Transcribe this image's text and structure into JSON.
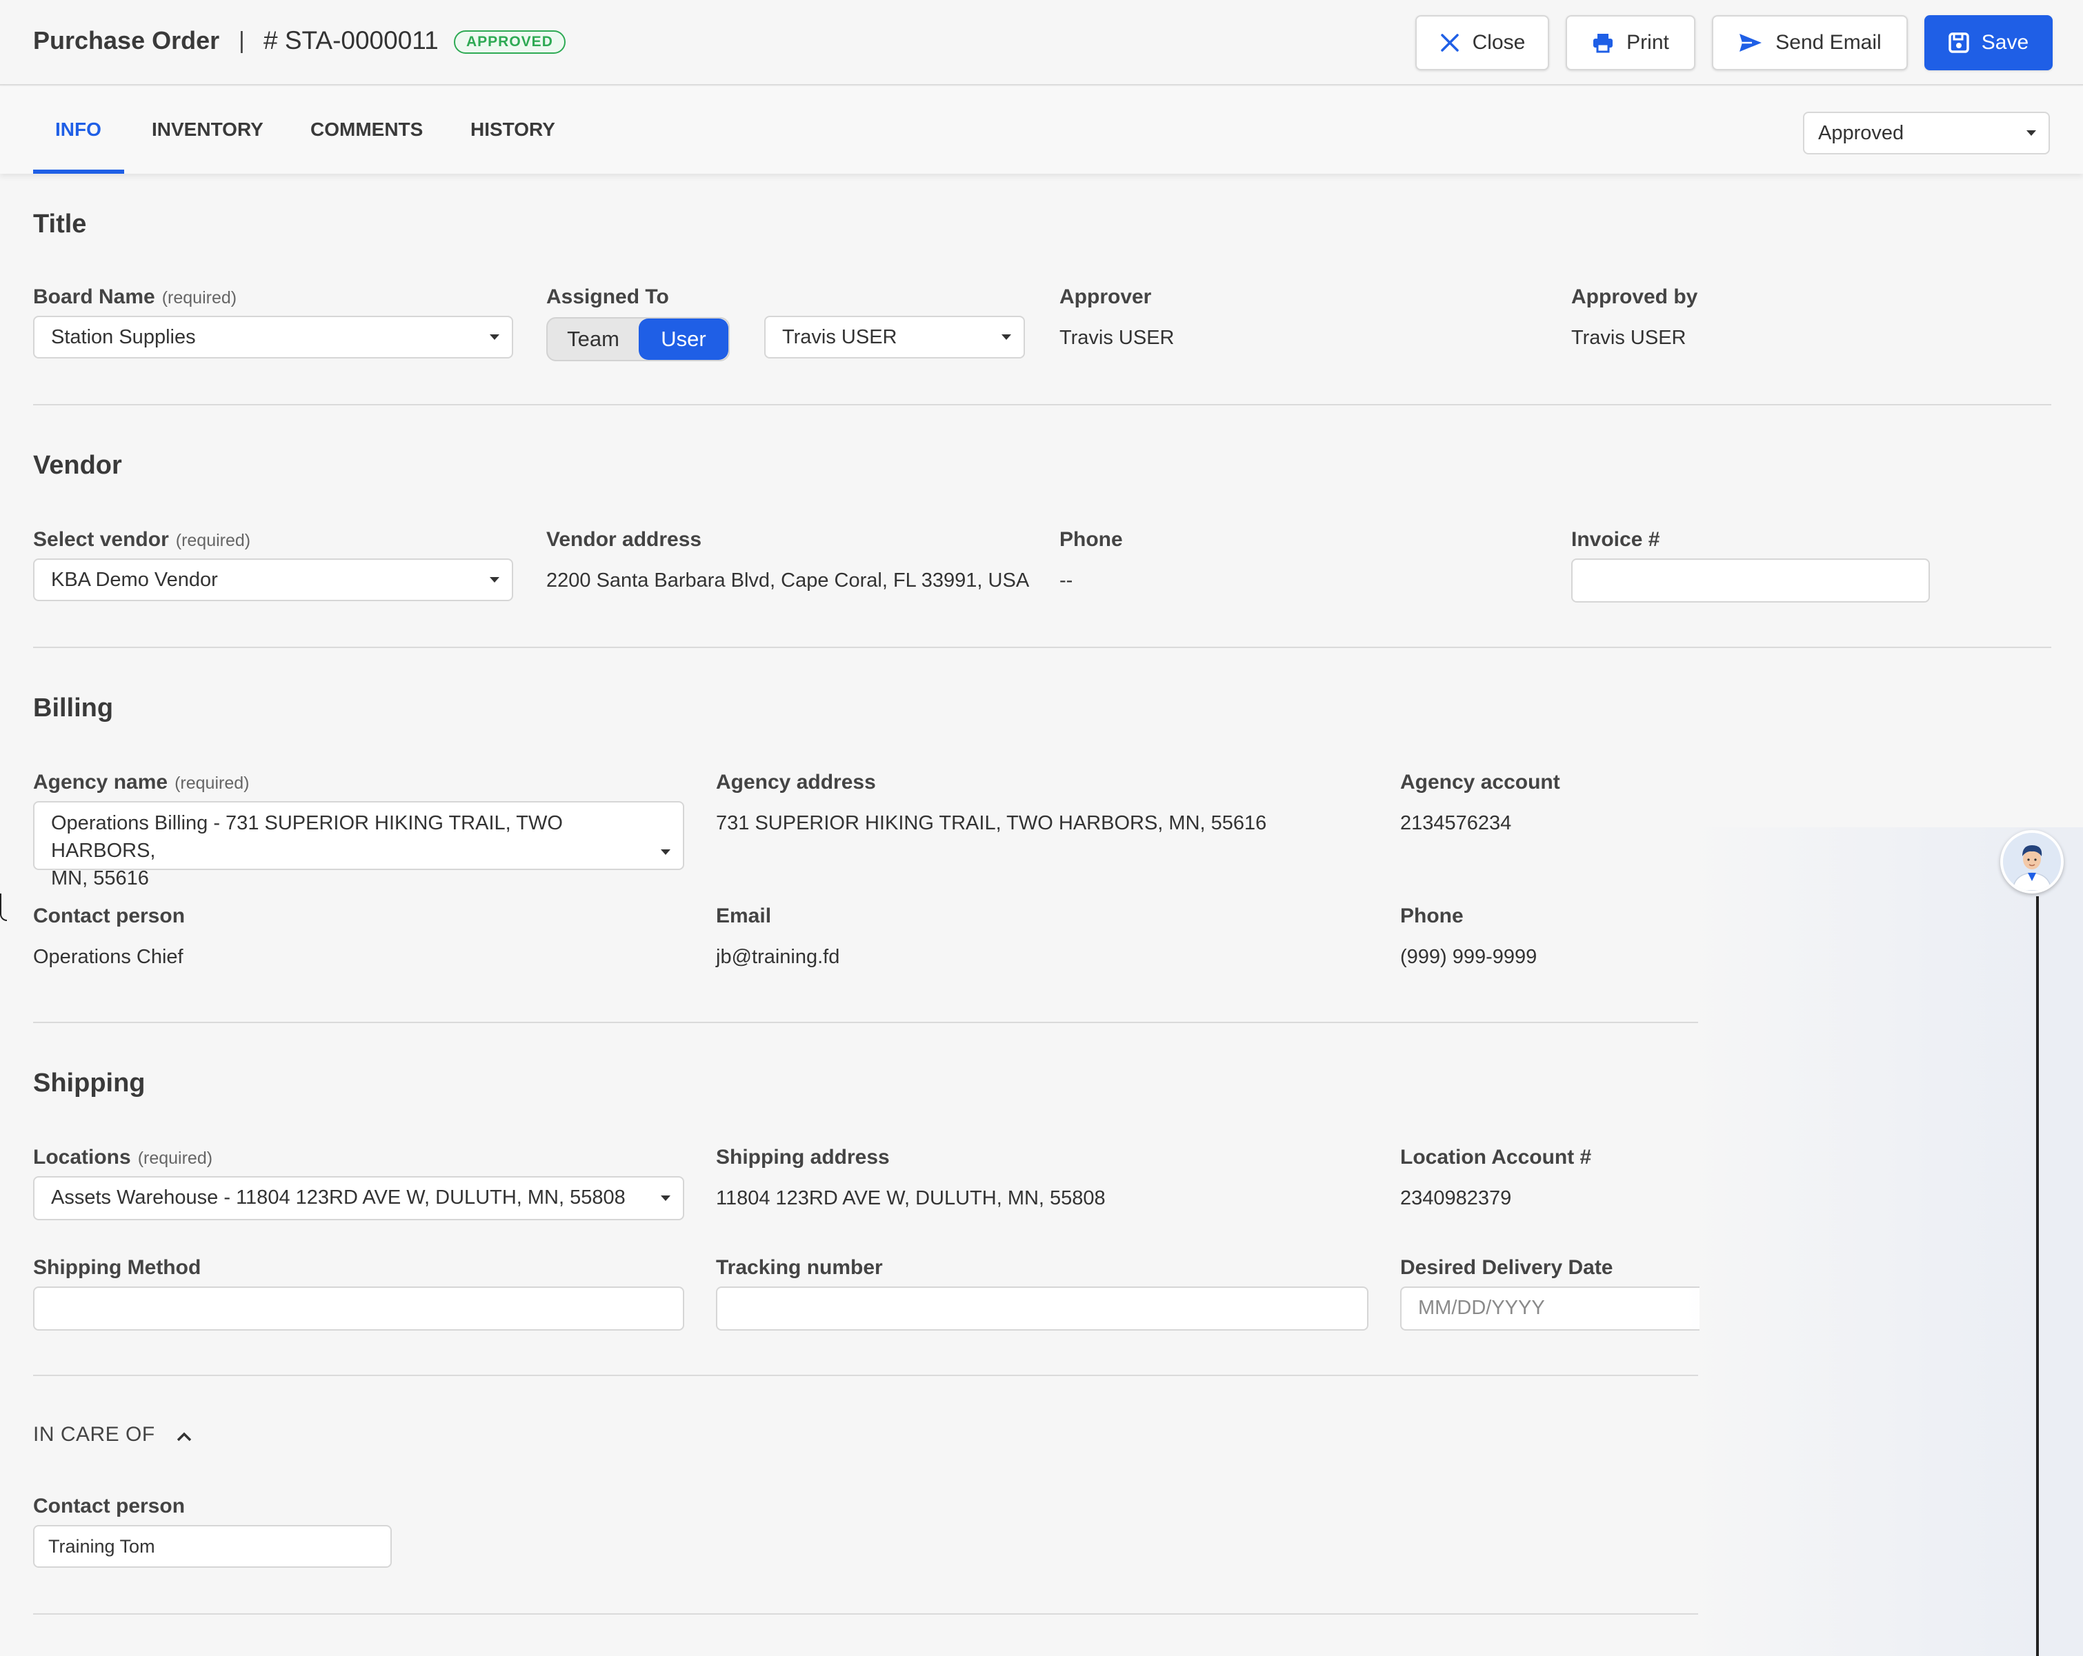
{
  "header": {
    "title": "Purchase Order",
    "separator": "|",
    "order_number": "# STA-0000011",
    "badge": "APPROVED",
    "buttons": {
      "close": "Close",
      "print": "Print",
      "send_email": "Send Email",
      "save": "Save"
    }
  },
  "tabs": [
    {
      "label": "INFO",
      "active": true
    },
    {
      "label": "INVENTORY",
      "active": false
    },
    {
      "label": "COMMENTS",
      "active": false
    },
    {
      "label": "HISTORY",
      "active": false
    }
  ],
  "status_select": {
    "value": "Approved"
  },
  "title_section": {
    "heading": "Title",
    "board_name_label": "Board Name",
    "required": "(required)",
    "board_name_value": "Station Supplies",
    "assigned_to_label": "Assigned To",
    "toggle": {
      "team": "Team",
      "user": "User",
      "selected": "User"
    },
    "assigned_user_value": "Travis USER",
    "approver_label": "Approver",
    "approver_value": "Travis USER",
    "approved_by_label": "Approved by",
    "approved_by_value": "Travis USER"
  },
  "vendor_section": {
    "heading": "Vendor",
    "select_vendor_label": "Select vendor",
    "required": "(required)",
    "select_vendor_value": "KBA Demo Vendor",
    "vendor_address_label": "Vendor address",
    "vendor_address_value": "2200 Santa Barbara Blvd, Cape Coral, FL 33991, USA",
    "phone_label": "Phone",
    "phone_value": "--",
    "invoice_label": "Invoice #",
    "invoice_value": ""
  },
  "billing_section": {
    "heading": "Billing",
    "agency_name_label": "Agency name",
    "required": "(required)",
    "agency_name_value_line1": "Operations Billing - 731 SUPERIOR HIKING TRAIL, TWO HARBORS,",
    "agency_name_value_line2": "MN, 55616",
    "agency_address_label": "Agency address",
    "agency_address_value": "731 SUPERIOR HIKING TRAIL, TWO HARBORS, MN, 55616",
    "agency_account_label": "Agency account",
    "agency_account_value": "2134576234",
    "contact_person_label": "Contact person",
    "contact_person_value": "Operations Chief",
    "email_label": "Email",
    "email_value": "jb@training.fd",
    "phone_label": "Phone",
    "phone_value": "(999) 999-9999"
  },
  "shipping_section": {
    "heading": "Shipping",
    "locations_label": "Locations",
    "required": "(required)",
    "locations_value": "Assets Warehouse - 11804 123RD AVE W, DULUTH, MN, 55808",
    "shipping_address_label": "Shipping address",
    "shipping_address_value": "11804 123RD AVE W, DULUTH, MN, 55808",
    "location_account_label": "Location Account #",
    "location_account_value": "2340982379",
    "shipping_method_label": "Shipping Method",
    "shipping_method_value": "",
    "tracking_number_label": "Tracking number",
    "tracking_number_value": "",
    "desired_delivery_label": "Desired Delivery Date",
    "desired_delivery_placeholder": "MM/DD/YYYY"
  },
  "in_care_of": {
    "heading": "IN CARE OF",
    "contact_person_label": "Contact person",
    "contact_person_value": "Training Tom"
  },
  "colors": {
    "primary": "#1f5fe6",
    "approved_badge": "#2eaa54",
    "background": "#f6f6f6"
  },
  "icons": [
    "close-icon",
    "print-icon",
    "send-icon",
    "save-icon",
    "chevron-up-icon",
    "dropdown-caret-icon",
    "assistant-avatar"
  ]
}
